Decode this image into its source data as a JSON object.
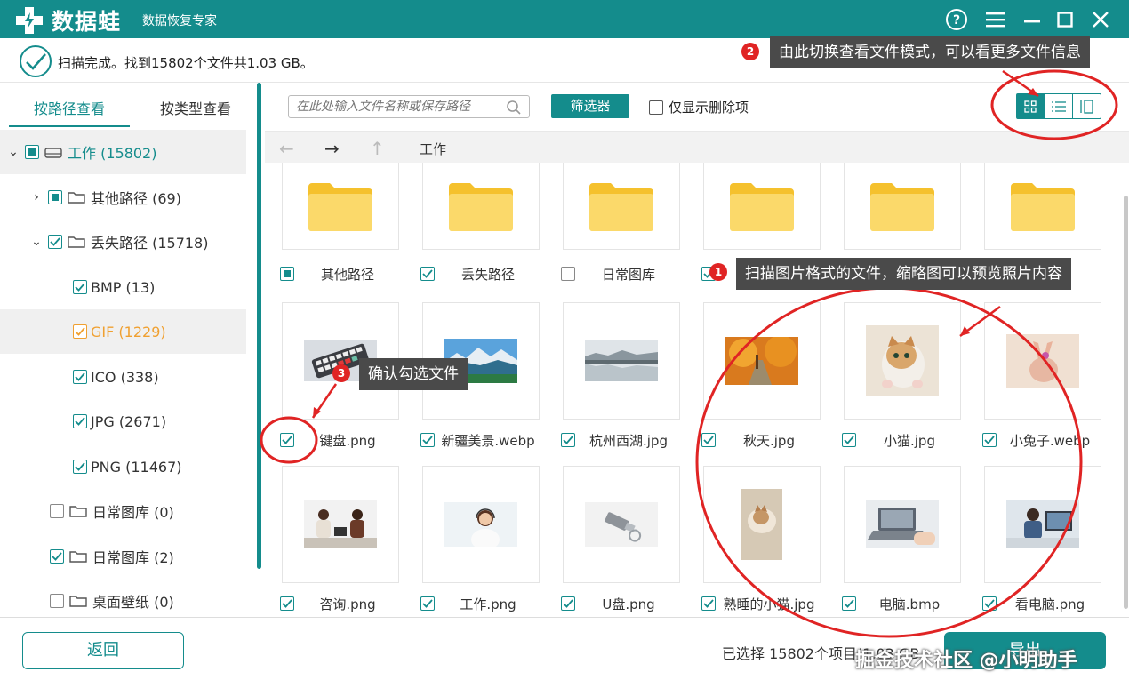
{
  "app": {
    "logo": "数据蛙",
    "subtitle": "数据恢复专家"
  },
  "scan": {
    "status": "扫描完成。找到15802个文件共1.03 GB。"
  },
  "sidebar": {
    "tabs": [
      "按路径查看",
      "按类型查看"
    ],
    "tree": [
      {
        "label": "工作 (15802)",
        "state": "partial",
        "expanded": true
      },
      {
        "label": "其他路径 (69)",
        "state": "partial",
        "expanded": false
      },
      {
        "label": "丢失路径 (15718)",
        "state": "checked",
        "expanded": true
      },
      {
        "label": "BMP (13)",
        "state": "checked"
      },
      {
        "label": "GIF (1229)",
        "state": "checked"
      },
      {
        "label": "ICO (338)",
        "state": "checked"
      },
      {
        "label": "JPG (2671)",
        "state": "checked"
      },
      {
        "label": "PNG (11467)",
        "state": "checked"
      },
      {
        "label": "日常图库 (0)",
        "state": "unchecked"
      },
      {
        "label": "日常图库 (2)",
        "state": "checked"
      },
      {
        "label": "桌面壁纸 (0)",
        "state": "unchecked"
      }
    ]
  },
  "toolbar": {
    "search_placeholder": "在此处输入文件名称或保存路径",
    "filter_label": "筛选器",
    "deleted_only_label": "仅显示删除项"
  },
  "nav": {
    "path": "工作"
  },
  "grid": {
    "folders": [
      {
        "name": "其他路径",
        "state": "partial"
      },
      {
        "name": "丢失路径",
        "state": "checked"
      },
      {
        "name": "日常图库",
        "state": "unchecked"
      },
      {
        "name": "",
        "state": "checked"
      },
      {
        "name": "",
        "state": "checked"
      },
      {
        "name": "",
        "state": "checked"
      }
    ],
    "images_row1": [
      {
        "name": "键盘.png",
        "thumb": "keyboard"
      },
      {
        "name": "新疆美景.webp",
        "thumb": "lake"
      },
      {
        "name": "杭州西湖.jpg",
        "thumb": "westlake"
      },
      {
        "name": "秋天.jpg",
        "thumb": "autumn"
      },
      {
        "name": "小猫.jpg",
        "thumb": "kitten"
      },
      {
        "name": "小兔子.webp",
        "thumb": "rabbit"
      }
    ],
    "images_row2": [
      {
        "name": "咨询.png",
        "thumb": "meeting"
      },
      {
        "name": "工作.png",
        "thumb": "headset"
      },
      {
        "name": "U盘.png",
        "thumb": "usb"
      },
      {
        "name": "熟睡的小猫.jpg",
        "thumb": "sleepcat"
      },
      {
        "name": "电脑.bmp",
        "thumb": "laptop"
      },
      {
        "name": "看电脑.png",
        "thumb": "office"
      }
    ]
  },
  "footer": {
    "back_label": "返回",
    "selected_info": "已选择 15802个项目(1.03 GB",
    "export_label": "导出"
  },
  "annotations": {
    "badge1": "1",
    "callout1": "扫描图片格式的文件，缩略图可以预览照片内容",
    "badge2": "2",
    "callout2": "由此切换查看文件模式，可以看更多文件信息",
    "badge3": "3",
    "callout3": "确认勾选文件"
  },
  "watermark": "掘金技术社区 @小明助手",
  "colors": {
    "accent": "#148c8c",
    "annotation_red": "#e02424",
    "callout_bg": "#4a4a4a"
  }
}
